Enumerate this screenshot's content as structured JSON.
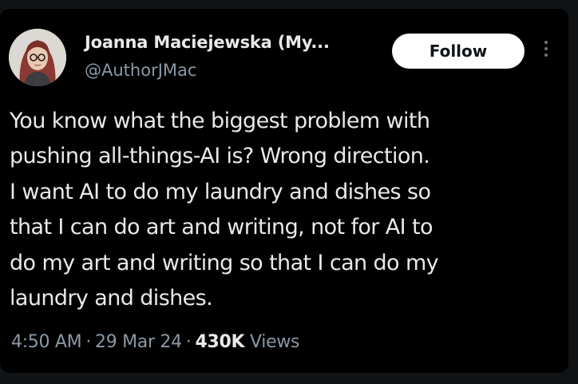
{
  "tweet": {
    "author": {
      "display_name": "Joanna Maciejewska (My...",
      "handle": "@AuthorJMac",
      "avatar_icon": "profile-photo"
    },
    "follow_label": "Follow",
    "more_icon": "more-vertical-icon",
    "text_lines": [
      "You know what the biggest problem with",
      "pushing all-things-AI is? Wrong direction.",
      "I want AI to do my laundry and dishes so",
      "that I can do art and writing, not for AI to",
      "do my art and writing so that I can do my",
      "laundry and dishes."
    ],
    "time": "4:50 AM",
    "date": "29 Mar 24",
    "separator": "·",
    "views_count": "430K",
    "views_label": "Views"
  },
  "colors": {
    "background": "#000000",
    "primary_text": "#e7e9ea",
    "secondary_text": "#8b98a5",
    "follow_bg": "#ffffff"
  }
}
